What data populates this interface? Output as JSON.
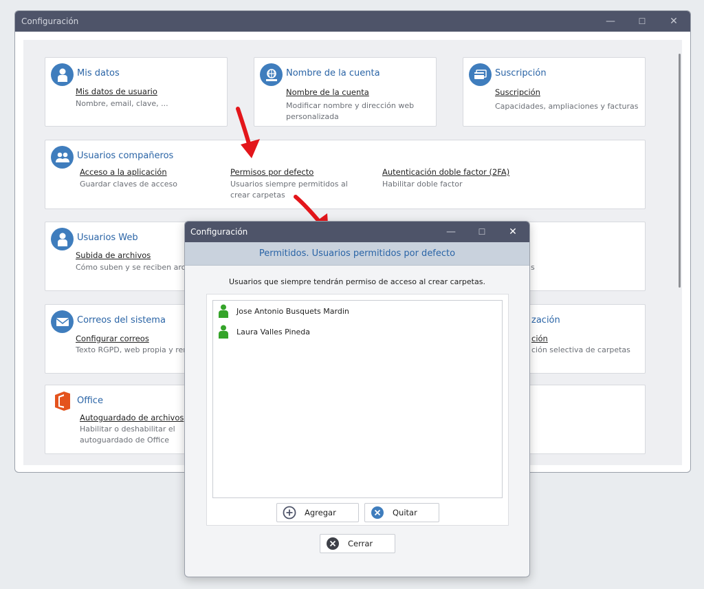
{
  "main_window": {
    "title": "Configuración",
    "controls": {
      "minimize": "—",
      "maximize": "☐",
      "close": "✕"
    }
  },
  "cards": {
    "mis_datos": {
      "title": "Mis datos",
      "link": "Mis datos de usuario",
      "desc": "Nombre, email, clave, ..."
    },
    "nombre_cuenta": {
      "title": "Nombre de la cuenta",
      "link": "Nombre de la cuenta",
      "desc": "Modificar nombre y dirección web personalizada"
    },
    "suscripcion": {
      "title": "Suscripción",
      "link": "Suscripción",
      "desc": "Capacidades, ampliaciones y facturas"
    },
    "usuarios_companeros": {
      "title": "Usuarios compañeros",
      "items": [
        {
          "link": "Acceso a la aplicación",
          "desc": "Guardar claves de acceso"
        },
        {
          "link": "Permisos por defecto",
          "desc": "Usuarios siempre permitidos al crear carpetas"
        },
        {
          "link": "Autenticación doble factor (2FA)",
          "desc": "Habilitar doble factor"
        }
      ]
    },
    "usuarios_web": {
      "title": "Usuarios Web",
      "link": "Subida de archivos",
      "desc": "Cómo suben y se reciben archi"
    },
    "usuarios_web_right": {
      "desc": "s"
    },
    "correos": {
      "title": "Correos del sistema",
      "link": "Configurar correos",
      "desc": "Texto RGPD, web propia y rem"
    },
    "sincronizacion": {
      "title": "zación",
      "link": "ción",
      "desc": "ción selectiva de carpetas"
    },
    "office": {
      "title": "Office",
      "link": "Autoguardado de archivos",
      "desc": "Habilitar o deshabilitar el autoguardado de Office"
    }
  },
  "dialog": {
    "title": "Configuración",
    "controls": {
      "minimize": "—",
      "maximize": "☐",
      "close": "✕"
    },
    "header": "Permitidos. Usuarios permitidos por defecto",
    "subtitle": "Usuarios que siempre tendrán permiso de acceso al crear carpetas.",
    "users": [
      {
        "name": "Jose Antonio Busquets Mardin"
      },
      {
        "name": "Laura Valles Pineda"
      }
    ],
    "buttons": {
      "add": "Agregar",
      "remove": "Quitar",
      "close": "Cerrar"
    }
  },
  "colors": {
    "titlebar": "#4e5469",
    "accent_blue": "#2a64a6",
    "icon_blue": "#3f7dbd",
    "arrow_red": "#e3161b",
    "user_green": "#35a42a",
    "office_orange": "#e4531d"
  }
}
